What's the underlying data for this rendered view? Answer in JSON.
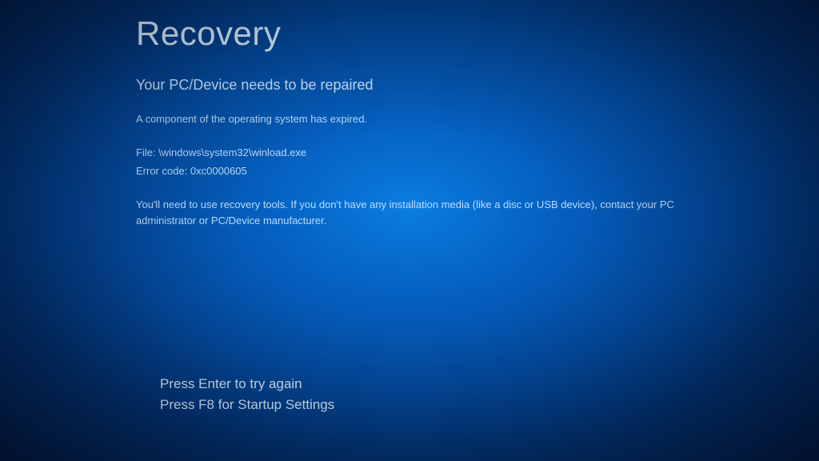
{
  "recovery": {
    "title": "Recovery",
    "subtitle": "Your PC/Device needs to be repaired",
    "expired_message": "A component of the operating system has expired.",
    "file_label": "File: \\windows\\system32\\winload.exe",
    "error_code_label": "Error code: 0xc0000605",
    "instructions": "You'll need to use recovery tools. If you don't have any installation media (like a disc or USB device), contact your PC administrator or PC/Device manufacturer.",
    "action_enter": "Press Enter to try again",
    "action_f8": "Press F8 for Startup Settings"
  }
}
